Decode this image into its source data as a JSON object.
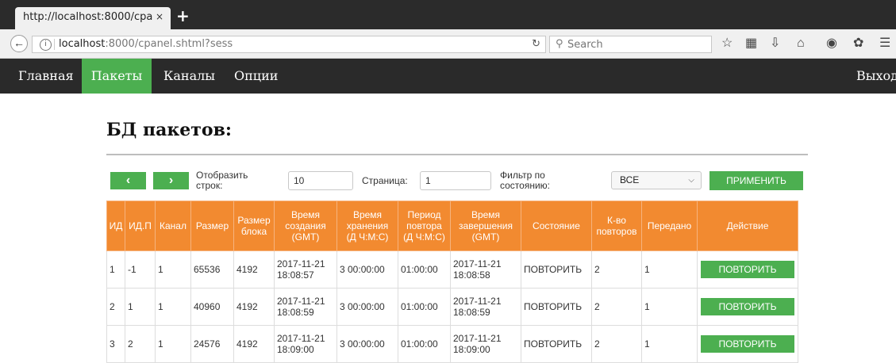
{
  "browser": {
    "tab_title": "http://localhost:8000/cpa",
    "tab_close": "×",
    "new_tab": "+",
    "url_host": "localhost",
    "url_rest": ":8000/cpanel.shtml?sess",
    "search_placeholder": "Search"
  },
  "nav": {
    "items": [
      "Главная",
      "Пакеты",
      "Каналы",
      "Опции"
    ],
    "active": "Пакеты",
    "logout": "Выход"
  },
  "page": {
    "title": "БД пакетов:"
  },
  "controls": {
    "prev": "‹",
    "next": "›",
    "rows_label_1": "Отобразить",
    "rows_label_2": "строк:",
    "rows_value": "10",
    "page_label": "Страница:",
    "page_value": "1",
    "filter_label_1": "Фильтр по",
    "filter_label_2": "состоянию:",
    "filter_value": "ВСЕ",
    "apply": "ПРИМЕНИТЬ"
  },
  "table": {
    "headers": [
      [
        "ИД"
      ],
      [
        "ИД.П"
      ],
      [
        "Канал"
      ],
      [
        "Размер"
      ],
      [
        "Размер",
        "блока"
      ],
      [
        "Время",
        "создания",
        "(GMT)"
      ],
      [
        "Время",
        "хранения",
        "(Д Ч:М:С)"
      ],
      [
        "Период",
        "повтора",
        "(Д Ч:М:С)"
      ],
      [
        "Время",
        "завершения",
        "(GMT)"
      ],
      [
        "Состояние"
      ],
      [
        "К-во",
        "повторов"
      ],
      [
        "Передано"
      ],
      [
        "Действие"
      ]
    ],
    "rows": [
      {
        "id": "1",
        "pid": "-1",
        "channel": "1",
        "size": "65536",
        "block": "4192",
        "created_date": "2017-11-21",
        "created_time": "18:08:57",
        "storage": "3 00:00:00",
        "period": "01:00:00",
        "finished_date": "2017-11-21",
        "finished_time": "18:08:58",
        "state": "ПОВТОРИТЬ",
        "repeats": "2",
        "sent": "1",
        "action": "ПОВТОРИТЬ"
      },
      {
        "id": "2",
        "pid": "1",
        "channel": "1",
        "size": "40960",
        "block": "4192",
        "created_date": "2017-11-21",
        "created_time": "18:08:59",
        "storage": "3 00:00:00",
        "period": "01:00:00",
        "finished_date": "2017-11-21",
        "finished_time": "18:08:59",
        "state": "ПОВТОРИТЬ",
        "repeats": "2",
        "sent": "1",
        "action": "ПОВТОРИТЬ"
      },
      {
        "id": "3",
        "pid": "2",
        "channel": "1",
        "size": "24576",
        "block": "4192",
        "created_date": "2017-11-21",
        "created_time": "18:09:00",
        "storage": "3 00:00:00",
        "period": "01:00:00",
        "finished_date": "2017-11-21",
        "finished_time": "18:09:00",
        "state": "ПОВТОРИТЬ",
        "repeats": "2",
        "sent": "1",
        "action": "ПОВТОРИТЬ"
      }
    ]
  },
  "colors": {
    "accent_green": "#4caf50",
    "header_orange": "#f28a30",
    "nav_dark": "#2a2a2a"
  }
}
